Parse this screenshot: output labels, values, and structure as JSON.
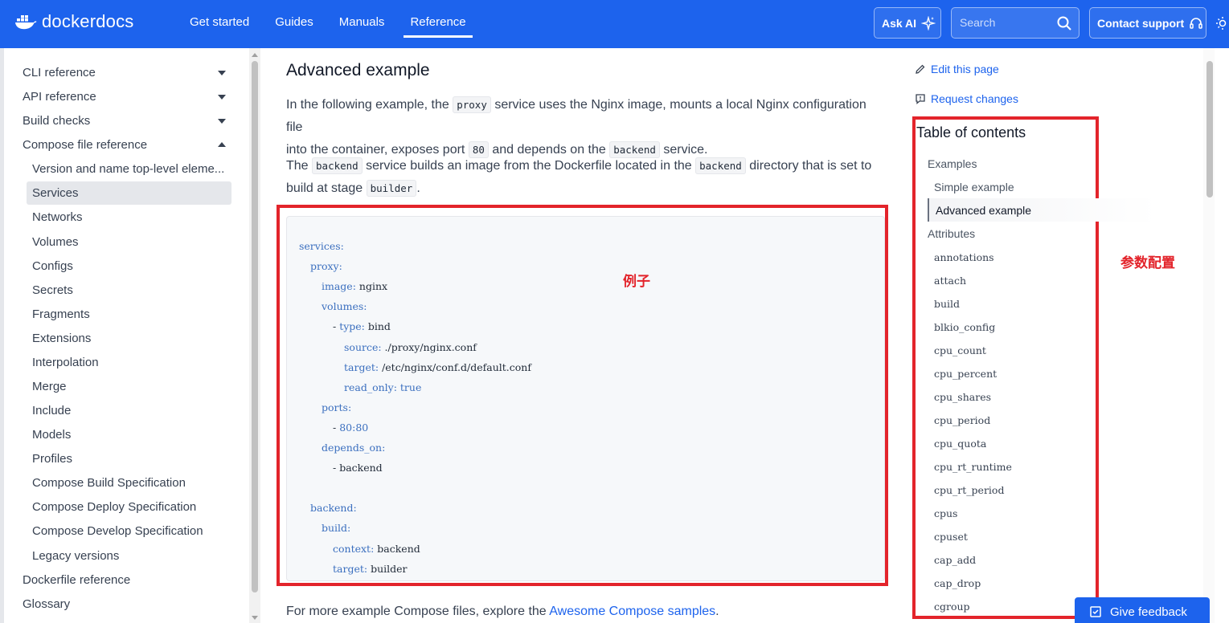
{
  "header": {
    "logo_text": "dockerdocs",
    "nav": [
      "Get started",
      "Guides",
      "Manuals",
      "Reference"
    ],
    "active_nav": "Reference",
    "ask_ai_label": "Ask AI",
    "search_placeholder": "Search",
    "contact_label": "Contact support",
    "brand_color": "#1d63ed"
  },
  "sidebar": {
    "items": [
      {
        "label": "CLI reference",
        "level": 0,
        "arrow": "down"
      },
      {
        "label": "API reference",
        "level": 0,
        "arrow": "down"
      },
      {
        "label": "Build checks",
        "level": 0,
        "arrow": "down"
      },
      {
        "label": "Compose file reference",
        "level": 0,
        "arrow": "up"
      },
      {
        "label": "Version and name top-level eleme...",
        "level": 1
      },
      {
        "label": "Services",
        "level": 1,
        "active": true
      },
      {
        "label": "Networks",
        "level": 1
      },
      {
        "label": "Volumes",
        "level": 1
      },
      {
        "label": "Configs",
        "level": 1
      },
      {
        "label": "Secrets",
        "level": 1
      },
      {
        "label": "Fragments",
        "level": 1
      },
      {
        "label": "Extensions",
        "level": 1
      },
      {
        "label": "Interpolation",
        "level": 1
      },
      {
        "label": "Merge",
        "level": 1
      },
      {
        "label": "Include",
        "level": 1
      },
      {
        "label": "Models",
        "level": 1
      },
      {
        "label": "Profiles",
        "level": 1
      },
      {
        "label": "Compose Build Specification",
        "level": 1
      },
      {
        "label": "Compose Deploy Specification",
        "level": 1
      },
      {
        "label": "Compose Develop Specification",
        "level": 1
      },
      {
        "label": "Legacy versions",
        "level": 1
      },
      {
        "label": "Dockerfile reference",
        "level": 0
      },
      {
        "label": "Glossary",
        "level": 0
      }
    ]
  },
  "main": {
    "heading": "Advanced example",
    "p1": {
      "t1": "In the following example, the ",
      "c1": "proxy",
      "t2": " service uses the Nginx image, mounts a local Nginx configuration file",
      "t3": "into the container, exposes port ",
      "c2": "80",
      "t4": " and depends on the ",
      "c3": "backend",
      "t5": " service."
    },
    "p2": {
      "t1": "The ",
      "c1": "backend",
      "t2": " service builds an image from the Dockerfile located in the ",
      "c2": "backend",
      "t3": " directory that is set to",
      "t4": "build at stage ",
      "c3": "builder",
      "t5": "."
    },
    "code_lines": [
      {
        "indent": 0,
        "key": "services:",
        "val": ""
      },
      {
        "indent": 1,
        "key": "proxy:",
        "val": ""
      },
      {
        "indent": 2,
        "key": "image:",
        "val": " nginx"
      },
      {
        "indent": 2,
        "key": "volumes:",
        "val": ""
      },
      {
        "indent": 3,
        "dash": "- ",
        "key": "type:",
        "val": " bind"
      },
      {
        "indent": 4,
        "key": "source:",
        "val": " ./proxy/nginx.conf"
      },
      {
        "indent": 4,
        "key": "target:",
        "val": " /etc/nginx/conf.d/default.conf"
      },
      {
        "indent": 4,
        "key": "read_only:",
        "val": " true",
        "valKeyword": true
      },
      {
        "indent": 2,
        "key": "ports:",
        "val": ""
      },
      {
        "indent": 3,
        "dash": "- ",
        "key": "",
        "val": "80:80",
        "valKeyword": true
      },
      {
        "indent": 2,
        "key": "depends_on:",
        "val": ""
      },
      {
        "indent": 3,
        "dash": "- ",
        "key": "",
        "val": "backend"
      },
      {
        "indent": 0,
        "key": "",
        "val": ""
      },
      {
        "indent": 1,
        "key": "backend:",
        "val": ""
      },
      {
        "indent": 2,
        "key": "build:",
        "val": ""
      },
      {
        "indent": 3,
        "key": "context:",
        "val": " backend"
      },
      {
        "indent": 3,
        "key": "target:",
        "val": " builder"
      }
    ],
    "footer_text": "For more example Compose files, explore the ",
    "footer_link": "Awesome Compose samples",
    "footer_end": ".",
    "annotation_code": "例子"
  },
  "right": {
    "edit_label": "Edit this page",
    "request_label": "Request changes",
    "toc_title": "Table of contents",
    "toc_examples": "Examples",
    "toc_simple": "Simple example",
    "toc_advanced": "Advanced example",
    "toc_attributes": "Attributes",
    "toc_attrs": [
      "annotations",
      "attach",
      "build",
      "blkio_config",
      "cpu_count",
      "cpu_percent",
      "cpu_shares",
      "cpu_period",
      "cpu_quota",
      "cpu_rt_runtime",
      "cpu_rt_period",
      "cpus",
      "cpuset",
      "cap_add",
      "cap_drop",
      "cgroup"
    ],
    "annotation_params": "参数配置",
    "feedback_label": "Give feedback"
  }
}
